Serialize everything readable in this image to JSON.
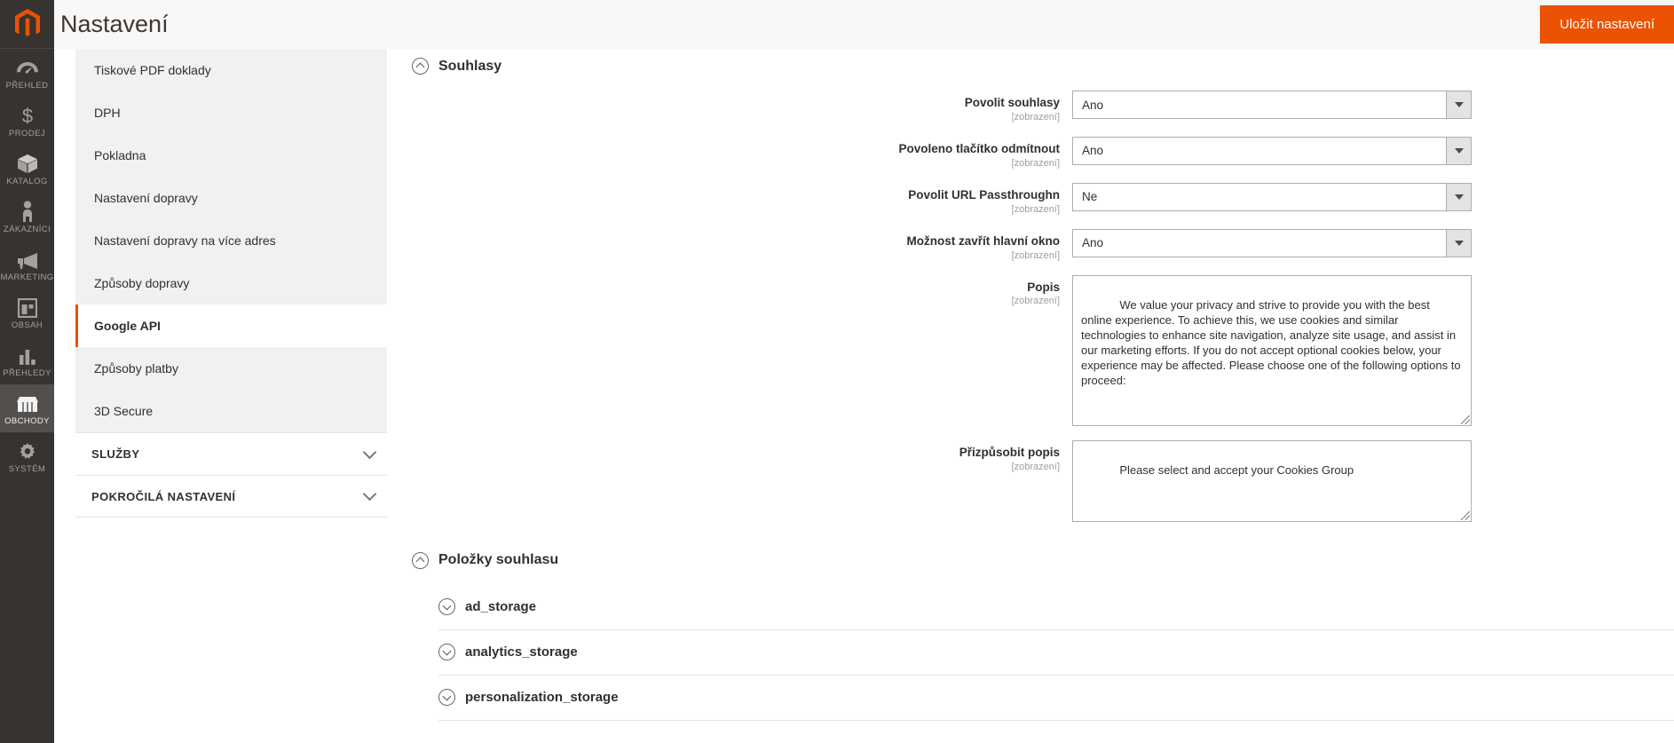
{
  "header": {
    "title": "Nastavení",
    "save_label": "Uložit nastavení",
    "accent": "#eb5202"
  },
  "rail": {
    "logo_icon": "magento-logo-icon",
    "items": [
      {
        "label": "PŘEHLED",
        "icon": "dashboard-icon",
        "active": false
      },
      {
        "label": "PRODEJ",
        "icon": "dollar-icon",
        "active": false
      },
      {
        "label": "KATALOG",
        "icon": "box-icon",
        "active": false
      },
      {
        "label": "ZÁKAZNÍCI",
        "icon": "person-icon",
        "active": false
      },
      {
        "label": "MARKETING",
        "icon": "megaphone-icon",
        "active": false
      },
      {
        "label": "OBSAH",
        "icon": "layout-icon",
        "active": false
      },
      {
        "label": "PŘEHLEDY",
        "icon": "bar-chart-icon",
        "active": false
      },
      {
        "label": "OBCHODY",
        "icon": "store-icon",
        "active": true
      },
      {
        "label": "SYSTÉM",
        "icon": "gear-icon",
        "active": false
      }
    ]
  },
  "subnav": {
    "items": [
      {
        "label": "Tiskové PDF doklady",
        "active": false
      },
      {
        "label": "DPH",
        "active": false
      },
      {
        "label": "Pokladna",
        "active": false
      },
      {
        "label": "Nastavení dopravy",
        "active": false
      },
      {
        "label": "Nastavení dopravy na více adres",
        "active": false
      },
      {
        "label": "Způsoby dopravy",
        "active": false
      },
      {
        "label": "Google API",
        "active": true
      },
      {
        "label": "Způsoby platby",
        "active": false
      },
      {
        "label": "3D Secure",
        "active": false
      }
    ],
    "sections": [
      {
        "label": "SLUŽBY"
      },
      {
        "label": "POKROČILÁ NASTAVENÍ"
      }
    ]
  },
  "main": {
    "consents_section": {
      "title": "Souhlasy",
      "expanded": true,
      "scope_note": "[zobrazení]",
      "fields": [
        {
          "label": "Povolit souhlasy",
          "scope": "[zobrazení]",
          "type": "select",
          "value": "Ano"
        },
        {
          "label": "Povoleno tlačítko odmítnout",
          "scope": "[zobrazení]",
          "type": "select",
          "value": "Ano"
        },
        {
          "label": "Povolit URL Passthroughn",
          "scope": "[zobrazení]",
          "type": "select",
          "value": "Ne"
        },
        {
          "label": "Možnost zavřít hlavní okno",
          "scope": "[zobrazení]",
          "type": "select",
          "value": "Ano"
        },
        {
          "label": "Popis",
          "scope": "[zobrazení]",
          "type": "textarea",
          "value": "We value your privacy and strive to provide you with the best online experience. To achieve this, we use cookies and similar technologies to enhance site navigation, analyze site usage, and assist in our marketing efforts. If you do not accept optional cookies below, your experience may be affected. Please choose one of the following options to proceed:"
        },
        {
          "label": "Přizpůsobit popis",
          "scope": "[zobrazení]",
          "type": "textarea-tall",
          "value": "Please select and accept your Cookies Group"
        }
      ]
    },
    "consent_items_section": {
      "title": "Položky souhlasu",
      "expanded": true,
      "items": [
        {
          "label": "ad_storage",
          "expanded": false
        },
        {
          "label": "analytics_storage",
          "expanded": false
        },
        {
          "label": "personalization_storage",
          "expanded": false
        }
      ]
    }
  }
}
